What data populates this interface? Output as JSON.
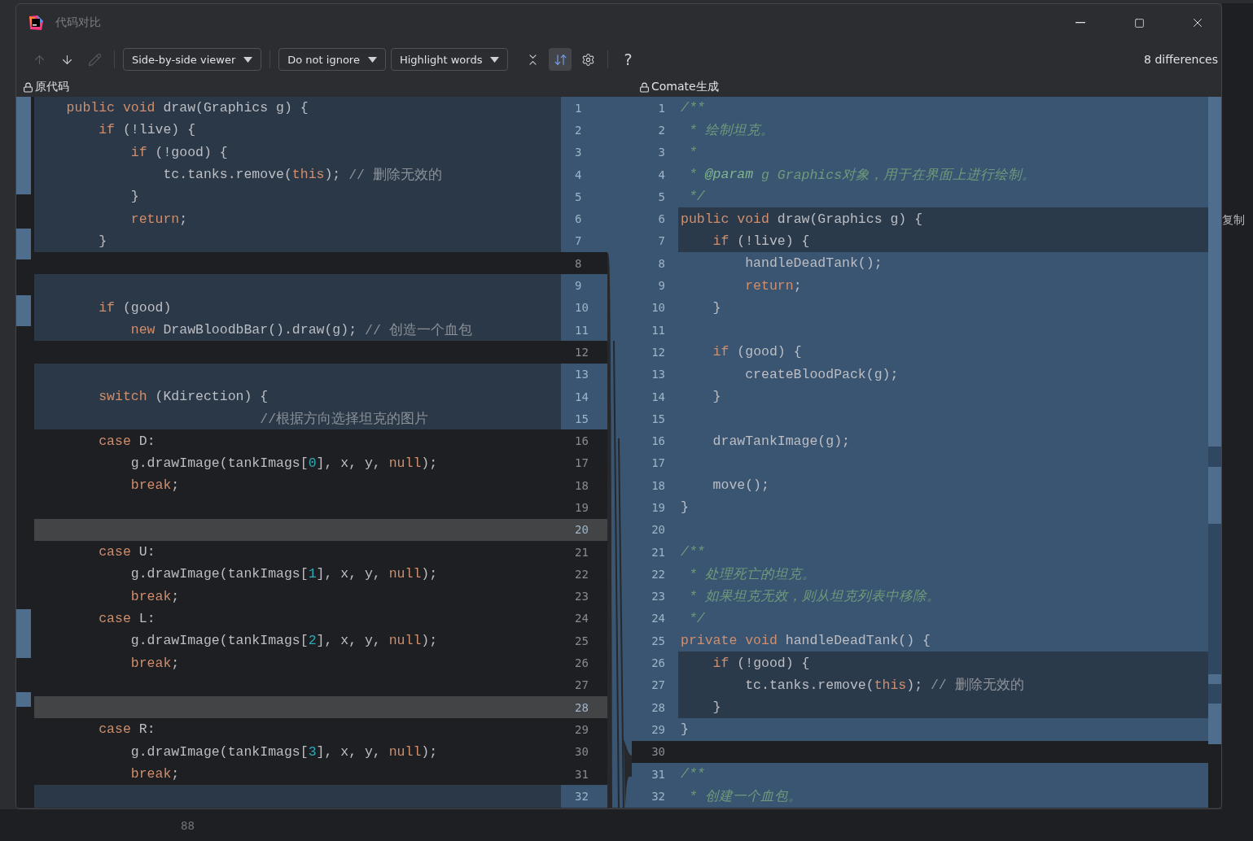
{
  "window": {
    "title": "代码对比"
  },
  "toolbar": {
    "navigation": [
      {
        "kind": "up",
        "disabled": true
      },
      {
        "kind": "down",
        "disabled": false
      },
      {
        "kind": "edit",
        "disabled": true
      }
    ],
    "dropdowns": [
      {
        "label": "Side-by-side viewer"
      },
      {
        "label": "Do not ignore"
      },
      {
        "label": "Highlight words"
      }
    ],
    "actions": [
      {
        "kind": "collapse",
        "selected": false
      },
      {
        "kind": "sync",
        "selected": true
      },
      {
        "kind": "settings",
        "selected": false
      }
    ],
    "help": "?",
    "summary": "8 differences"
  },
  "left": {
    "title": "原代码",
    "lines": [
      {
        "number": "1",
        "kind": "modified",
        "segments": [
          {
            "kind": "keyword",
            "text": "    public void"
          },
          {
            "kind": "plain",
            "text": " draw(Graphics g) {"
          }
        ]
      },
      {
        "number": "2",
        "kind": "modified",
        "segments": [
          {
            "kind": "keyword",
            "text": "        if"
          },
          {
            "kind": "plain",
            "text": " (!live) {"
          }
        ]
      },
      {
        "number": "3",
        "kind": "modified",
        "segments": [
          {
            "kind": "keyword",
            "text": "            if"
          },
          {
            "kind": "plain",
            "text": " (!good) {"
          }
        ]
      },
      {
        "number": "4",
        "kind": "modified",
        "segments": [
          {
            "kind": "plain",
            "text": "                tc.tanks.remove("
          },
          {
            "kind": "keyword",
            "text": "this"
          },
          {
            "kind": "plain",
            "text": "); "
          },
          {
            "kind": "comment",
            "text": "// 删除无效的"
          }
        ]
      },
      {
        "number": "5",
        "kind": "modified",
        "segments": [
          {
            "kind": "plain",
            "text": "            }"
          }
        ]
      },
      {
        "number": "6",
        "kind": "modified",
        "segments": [
          {
            "kind": "keyword",
            "text": "            return"
          },
          {
            "kind": "plain",
            "text": ";"
          }
        ]
      },
      {
        "number": "7",
        "kind": "modified",
        "segments": [
          {
            "kind": "plain",
            "text": "        }"
          }
        ]
      },
      {
        "number": "8",
        "kind": "equal"
      },
      {
        "number": "9",
        "kind": "modified"
      },
      {
        "number": "10",
        "kind": "modified",
        "segments": [
          {
            "kind": "keyword",
            "text": "        if"
          },
          {
            "kind": "plain",
            "text": " (good)"
          }
        ]
      },
      {
        "number": "11",
        "kind": "modified",
        "segments": [
          {
            "kind": "keyword",
            "text": "            new"
          },
          {
            "kind": "plain",
            "text": " DrawBloodbBar().draw(g); "
          },
          {
            "kind": "comment",
            "text": "// 创造一个血包"
          }
        ]
      },
      {
        "number": "12",
        "kind": "equal"
      },
      {
        "number": "13",
        "kind": "modified"
      },
      {
        "number": "14",
        "kind": "modified",
        "segments": [
          {
            "kind": "keyword",
            "text": "        switch"
          },
          {
            "kind": "plain",
            "text": " (Kdirection) {"
          }
        ]
      },
      {
        "number": "15",
        "kind": "modified",
        "segments": [
          {
            "kind": "comment",
            "text": "                            //根据方向选择坦克的图片"
          }
        ]
      },
      {
        "number": "16",
        "kind": "equal",
        "segments": [
          {
            "kind": "keyword",
            "text": "        case"
          },
          {
            "kind": "plain",
            "text": " D:"
          }
        ]
      },
      {
        "number": "17",
        "kind": "equal",
        "segments": [
          {
            "kind": "plain",
            "text": "            g.drawImage(tankImags["
          },
          {
            "kind": "number",
            "text": "0"
          },
          {
            "kind": "plain",
            "text": "], x, y, "
          },
          {
            "kind": "keyword",
            "text": "null"
          },
          {
            "kind": "plain",
            "text": ");"
          }
        ]
      },
      {
        "number": "18",
        "kind": "equal",
        "segments": [
          {
            "kind": "keyword",
            "text": "            break"
          },
          {
            "kind": "plain",
            "text": ";"
          }
        ]
      },
      {
        "number": "19",
        "kind": "equal"
      },
      {
        "number": "20",
        "kind": "deleted"
      },
      {
        "number": "21",
        "kind": "equal",
        "segments": [
          {
            "kind": "keyword",
            "text": "        case"
          },
          {
            "kind": "plain",
            "text": " U:"
          }
        ]
      },
      {
        "number": "22",
        "kind": "equal",
        "segments": [
          {
            "kind": "plain",
            "text": "            g.drawImage(tankImags["
          },
          {
            "kind": "number",
            "text": "1"
          },
          {
            "kind": "plain",
            "text": "], x, y, "
          },
          {
            "kind": "keyword",
            "text": "null"
          },
          {
            "kind": "plain",
            "text": ");"
          }
        ]
      },
      {
        "number": "23",
        "kind": "equal",
        "segments": [
          {
            "kind": "keyword",
            "text": "            break"
          },
          {
            "kind": "plain",
            "text": ";"
          }
        ]
      },
      {
        "number": "24",
        "kind": "equal",
        "segments": [
          {
            "kind": "keyword",
            "text": "        case"
          },
          {
            "kind": "plain",
            "text": " L:"
          }
        ]
      },
      {
        "number": "25",
        "kind": "equal",
        "segments": [
          {
            "kind": "plain",
            "text": "            g.drawImage(tankImags["
          },
          {
            "kind": "number",
            "text": "2"
          },
          {
            "kind": "plain",
            "text": "], x, y, "
          },
          {
            "kind": "keyword",
            "text": "null"
          },
          {
            "kind": "plain",
            "text": ");"
          }
        ]
      },
      {
        "number": "26",
        "kind": "equal",
        "segments": [
          {
            "kind": "keyword",
            "text": "            break"
          },
          {
            "kind": "plain",
            "text": ";"
          }
        ]
      },
      {
        "number": "27",
        "kind": "equal"
      },
      {
        "number": "28",
        "kind": "deleted"
      },
      {
        "number": "29",
        "kind": "equal",
        "segments": [
          {
            "kind": "keyword",
            "text": "        case"
          },
          {
            "kind": "plain",
            "text": " R:"
          }
        ]
      },
      {
        "number": "30",
        "kind": "equal",
        "segments": [
          {
            "kind": "plain",
            "text": "            g.drawImage(tankImags["
          },
          {
            "kind": "number",
            "text": "3"
          },
          {
            "kind": "plain",
            "text": "], x, y, "
          },
          {
            "kind": "keyword",
            "text": "null"
          },
          {
            "kind": "plain",
            "text": ");"
          }
        ]
      },
      {
        "number": "31",
        "kind": "equal",
        "segments": [
          {
            "kind": "keyword",
            "text": "            break"
          },
          {
            "kind": "plain",
            "text": ";"
          }
        ]
      },
      {
        "number": "32",
        "kind": "modified"
      }
    ]
  },
  "right": {
    "title": "Comate生成",
    "lines": [
      {
        "number": "1",
        "kind": "inserted",
        "segments": [
          {
            "kind": "doc",
            "text": "/**"
          }
        ]
      },
      {
        "number": "2",
        "kind": "inserted",
        "segments": [
          {
            "kind": "doc",
            "text": " * 绘制坦克。"
          }
        ]
      },
      {
        "number": "3",
        "kind": "inserted",
        "segments": [
          {
            "kind": "doc",
            "text": " *"
          }
        ]
      },
      {
        "number": "4",
        "kind": "inserted",
        "segments": [
          {
            "kind": "doc",
            "text": " * "
          },
          {
            "kind": "tag",
            "text": "@param"
          },
          {
            "kind": "doc",
            "text": " g Graphics对象，用于在界面上进行绘制。"
          }
        ]
      },
      {
        "number": "5",
        "kind": "inserted",
        "segments": [
          {
            "kind": "doc",
            "text": " */"
          }
        ]
      },
      {
        "number": "6",
        "kind": "modified",
        "segments": [
          {
            "kind": "keyword",
            "text": "public void"
          },
          {
            "kind": "plain",
            "text": " draw(Graphics g) {"
          }
        ]
      },
      {
        "number": "7",
        "kind": "modified",
        "segments": [
          {
            "kind": "keyword",
            "text": "    if"
          },
          {
            "kind": "plain",
            "text": " (!live) {"
          }
        ]
      },
      {
        "number": "8",
        "kind": "inserted",
        "segments": [
          {
            "kind": "plain",
            "text": "        handleDeadTank();"
          }
        ]
      },
      {
        "number": "9",
        "kind": "inserted",
        "segments": [
          {
            "kind": "keyword",
            "text": "        return"
          },
          {
            "kind": "plain",
            "text": ";"
          }
        ]
      },
      {
        "number": "10",
        "kind": "inserted",
        "segments": [
          {
            "kind": "plain",
            "text": "    }"
          }
        ]
      },
      {
        "number": "11",
        "kind": "inserted"
      },
      {
        "number": "12",
        "kind": "inserted",
        "segments": [
          {
            "kind": "keyword",
            "text": "    if"
          },
          {
            "kind": "plain",
            "text": " (good) {"
          }
        ]
      },
      {
        "number": "13",
        "kind": "inserted",
        "segments": [
          {
            "kind": "plain",
            "text": "        createBloodPack(g);"
          }
        ]
      },
      {
        "number": "14",
        "kind": "inserted",
        "segments": [
          {
            "kind": "plain",
            "text": "    }"
          }
        ]
      },
      {
        "number": "15",
        "kind": "inserted"
      },
      {
        "number": "16",
        "kind": "inserted",
        "segments": [
          {
            "kind": "plain",
            "text": "    drawTankImage(g);"
          }
        ]
      },
      {
        "number": "17",
        "kind": "inserted"
      },
      {
        "number": "18",
        "kind": "inserted",
        "segments": [
          {
            "kind": "plain",
            "text": "    move();"
          }
        ]
      },
      {
        "number": "19",
        "kind": "inserted",
        "segments": [
          {
            "kind": "plain",
            "text": "}"
          }
        ]
      },
      {
        "number": "20",
        "kind": "inserted"
      },
      {
        "number": "21",
        "kind": "inserted",
        "segments": [
          {
            "kind": "doc",
            "text": "/**"
          }
        ]
      },
      {
        "number": "22",
        "kind": "inserted",
        "segments": [
          {
            "kind": "doc",
            "text": " * 处理死亡的坦克。"
          }
        ]
      },
      {
        "number": "23",
        "kind": "inserted",
        "segments": [
          {
            "kind": "doc",
            "text": " * 如果坦克无效，则从坦克列表中移除。"
          }
        ]
      },
      {
        "number": "24",
        "kind": "inserted",
        "segments": [
          {
            "kind": "doc",
            "text": " */"
          }
        ]
      },
      {
        "number": "25",
        "kind": "inserted",
        "segments": [
          {
            "kind": "keyword",
            "text": "private void"
          },
          {
            "kind": "plain",
            "text": " handleDeadTank() {"
          }
        ]
      },
      {
        "number": "26",
        "kind": "modified",
        "segments": [
          {
            "kind": "keyword",
            "text": "    if"
          },
          {
            "kind": "plain",
            "text": " (!good) {"
          }
        ]
      },
      {
        "number": "27",
        "kind": "modified",
        "segments": [
          {
            "kind": "plain",
            "text": "        tc.tanks.remove("
          },
          {
            "kind": "keyword",
            "text": "this"
          },
          {
            "kind": "plain",
            "text": "); "
          },
          {
            "kind": "comment",
            "text": "// 删除无效的"
          }
        ]
      },
      {
        "number": "28",
        "kind": "modified",
        "segments": [
          {
            "kind": "plain",
            "text": "    }"
          }
        ]
      },
      {
        "number": "29",
        "kind": "inserted",
        "segments": [
          {
            "kind": "plain",
            "text": "}"
          }
        ]
      },
      {
        "number": "30",
        "kind": "equal"
      },
      {
        "number": "31",
        "kind": "inserted",
        "segments": [
          {
            "kind": "doc",
            "text": "/**"
          }
        ]
      },
      {
        "number": "32",
        "kind": "inserted",
        "segments": [
          {
            "kind": "doc",
            "text": " * 创建一个血包。"
          }
        ]
      }
    ]
  },
  "background": {
    "side_label": "复制",
    "line_number": "88"
  }
}
